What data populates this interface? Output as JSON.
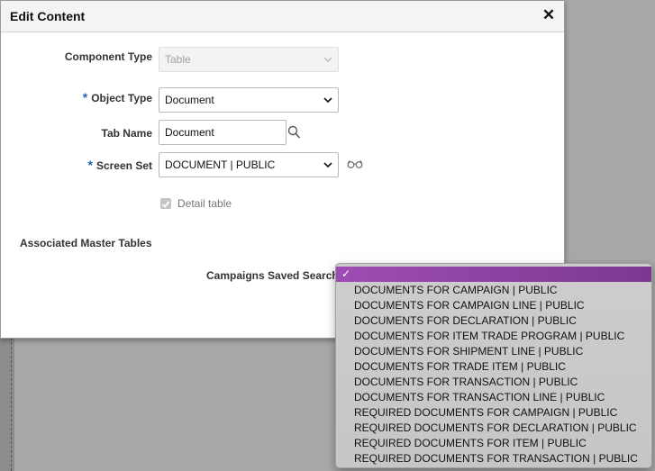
{
  "dialog": {
    "title": "Edit Content",
    "close_icon": "close-icon"
  },
  "form": {
    "component_type": {
      "label": "Component Type",
      "value": "Table",
      "disabled": true
    },
    "object_type": {
      "label": "Object Type",
      "required": true,
      "value": "Document"
    },
    "tab_name": {
      "label": "Tab Name",
      "value": "Document",
      "icon": "search-icon"
    },
    "screen_set": {
      "label": "Screen Set",
      "required": true,
      "value": "DOCUMENT | PUBLIC",
      "icon": "glasses-icon"
    },
    "detail_table": {
      "label": "Detail table",
      "checked": true,
      "disabled": true
    },
    "required_marker": "*"
  },
  "associated": {
    "section_title": "Associated Master Tables",
    "saved_search_label": "Campaigns Saved Search"
  },
  "dropdown": {
    "selected_mark": "✓",
    "selected_value": "",
    "accent": "#8c42a2",
    "options": [
      "DOCUMENTS FOR CAMPAIGN | PUBLIC",
      "DOCUMENTS FOR CAMPAIGN LINE | PUBLIC",
      "DOCUMENTS FOR DECLARATION | PUBLIC",
      "DOCUMENTS FOR ITEM TRADE PROGRAM | PUBLIC",
      "DOCUMENTS FOR SHIPMENT LINE | PUBLIC",
      "DOCUMENTS FOR TRADE ITEM | PUBLIC",
      "DOCUMENTS FOR TRANSACTION | PUBLIC",
      "DOCUMENTS FOR TRANSACTION LINE | PUBLIC",
      "REQUIRED DOCUMENTS FOR CAMPAIGN | PUBLIC",
      "REQUIRED DOCUMENTS FOR DECLARATION | PUBLIC",
      "REQUIRED DOCUMENTS FOR ITEM | PUBLIC",
      "REQUIRED DOCUMENTS FOR TRANSACTION | PUBLIC"
    ]
  }
}
